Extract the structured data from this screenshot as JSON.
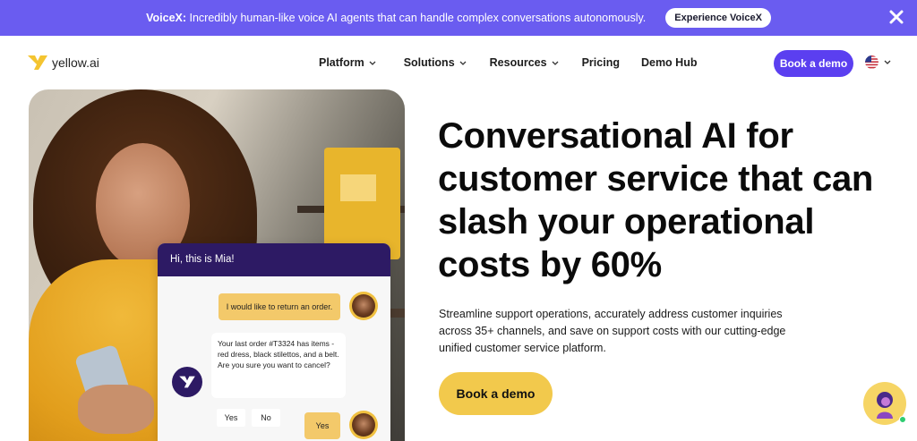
{
  "announcement": {
    "brand": "VoiceX:",
    "message": " Incredibly human-like voice AI agents that can handle complex conversations autonomously.",
    "cta": "Experience VoiceX"
  },
  "nav": {
    "logo_text": "yellow.ai",
    "links": [
      {
        "label": "Platform",
        "dropdown": true
      },
      {
        "label": "Solutions",
        "dropdown": true
      },
      {
        "label": "Resources",
        "dropdown": true
      },
      {
        "label": "Pricing",
        "dropdown": false
      },
      {
        "label": "Demo Hub",
        "dropdown": false
      }
    ],
    "cta": "Book a demo",
    "language_icon": "us-flag-icon"
  },
  "chat": {
    "header": "Hi, this is Mia!",
    "user_message_1": "I would like to return an order.",
    "bot_message": "Your last order #T3324 has items - red dress, black stilettos, and a belt. Are you sure you want to cancel?",
    "option_yes": "Yes",
    "option_no": "No",
    "user_message_2": "Yes"
  },
  "hero": {
    "headline": "Conversational AI for customer service that can slash your operational costs by 60%",
    "subtext": "Streamline support operations, accurately address customer inquiries across 35+ channels, and save on support costs with our cutting-edge unified customer service platform.",
    "cta": "Book a demo"
  },
  "colors": {
    "announcement_bg": "#6a5cf0",
    "nav_cta_bg": "#5b3ff0",
    "hero_cta_bg": "#f2c94c",
    "chat_header_bg": "#2d1a64"
  }
}
